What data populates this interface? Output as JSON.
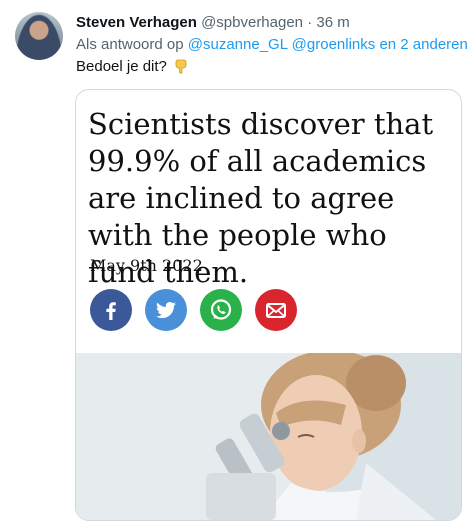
{
  "tweet": {
    "display_name": "Steven Verhagen",
    "handle": "@spbverhagen",
    "separator": "·",
    "time": "36 m",
    "reply_prefix": "Als antwoord op",
    "reply_mention_1": "@suzanne_GL",
    "reply_mention_2": "@groenlinks",
    "reply_suffix": "en 2 anderen",
    "text": "Bedoel je dit?",
    "emoji_icon": "backhand-index-pointing-down-icon"
  },
  "card": {
    "headline": "Scientists discover that 99.9% of all academics are inclined to agree with the people who fund them.",
    "date": "May 9th 2022",
    "share_buttons": [
      {
        "name": "facebook",
        "color": "#3b5998",
        "icon": "facebook-icon"
      },
      {
        "name": "twitter",
        "color": "#4a90d9",
        "icon": "twitter-bird-icon"
      },
      {
        "name": "whatsapp",
        "color": "#2bb14a",
        "icon": "whatsapp-icon"
      },
      {
        "name": "email",
        "color": "#d9262e",
        "icon": "envelope-icon"
      }
    ],
    "photo_description_icon": "scientist-microscope-photo"
  },
  "colors": {
    "link": "#1d9bf0",
    "secondary_text": "#536471",
    "primary_text": "#0f1419"
  }
}
